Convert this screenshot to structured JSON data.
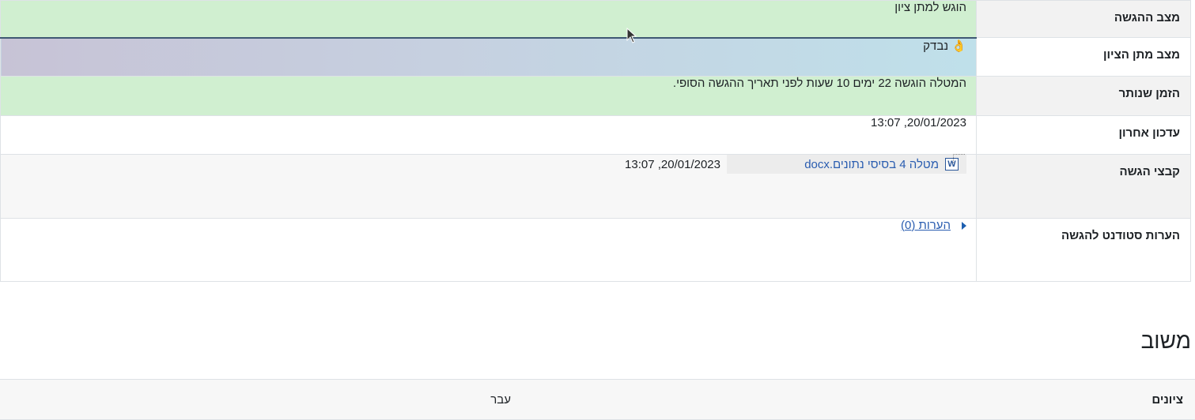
{
  "submission_status": {
    "rows": [
      {
        "label": "מצב ההגשה",
        "value": "הוגש למתן ציון"
      },
      {
        "label": "מצב מתן הציון",
        "value": "👌 נבדק"
      },
      {
        "label": "הזמן שנותר",
        "value": "המטלה הוגשה 22 ימים 10 שעות לפני תאריך ההגשה הסופי."
      },
      {
        "label": "עדכון אחרון",
        "value": "20/01/2023, 13:07"
      },
      {
        "label": "קבצי הגשה",
        "file_name": "מטלה 4 בסיסי נתונים.docx",
        "file_date": "20/01/2023, 13:07",
        "file_icon": "word-document-icon",
        "file_icon_letter": "W"
      },
      {
        "label": "הערות סטודנט להגשה",
        "comments_link": "הערות (0)"
      }
    ]
  },
  "feedback": {
    "title": "משוב",
    "grade_label": "ציונים",
    "grade_value": "עבר"
  },
  "colors": {
    "submitted_green": "#d0efd0",
    "link_blue": "#2a5db0",
    "row_alt": "#f7f7f7"
  }
}
